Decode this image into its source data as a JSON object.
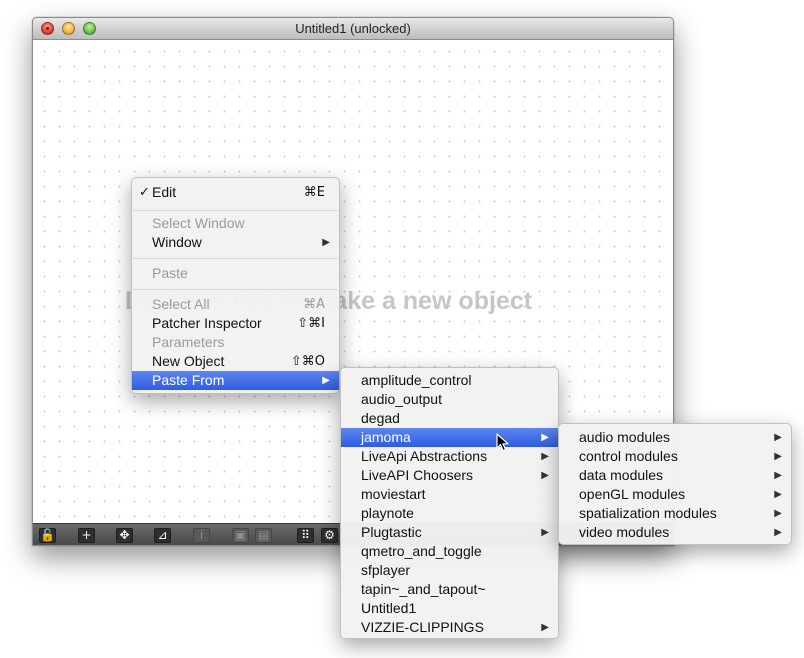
{
  "window": {
    "title": "Untitled1 (unlocked)",
    "canvas_hint": "Double-click to make a new object"
  },
  "toolbar": {
    "buttons": [
      {
        "icon": "lock-icon",
        "glyph": "🔓"
      },
      {
        "icon": "plus-icon",
        "glyph": "+"
      },
      {
        "icon": "move-icon",
        "glyph": "✥"
      },
      {
        "icon": "presentation-icon",
        "glyph": "⊿"
      },
      {
        "icon": "info-icon",
        "glyph": "i"
      },
      {
        "icon": "object-icon",
        "glyph": "▣"
      },
      {
        "icon": "object-stack-icon",
        "glyph": "▤"
      },
      {
        "icon": "grid-icon",
        "glyph": "⠿"
      },
      {
        "icon": "gear-icon",
        "glyph": "⚙"
      }
    ]
  },
  "context_menu": {
    "items": [
      {
        "label": "Edit",
        "checked": true,
        "check_glyph": "✓",
        "shortcut": "⌘E",
        "enabled": true
      },
      {
        "label": "Select Window",
        "enabled": false
      },
      {
        "label": "Window",
        "submenu": true,
        "enabled": true
      },
      {
        "label": "Paste",
        "enabled": false
      },
      {
        "label": "Select All",
        "shortcut": "⌘A",
        "enabled": false
      },
      {
        "label": "Patcher Inspector",
        "shortcut": "⇧⌘I",
        "enabled": true
      },
      {
        "label": "Parameters",
        "enabled": false
      },
      {
        "label": "New Object",
        "shortcut": "⇧⌘O",
        "enabled": true
      },
      {
        "label": "Paste From",
        "submenu": true,
        "enabled": true,
        "selected": true
      }
    ]
  },
  "paste_from_menu": {
    "items": [
      {
        "label": "amplitude_control"
      },
      {
        "label": "audio_output"
      },
      {
        "label": "degad"
      },
      {
        "label": "jamoma",
        "submenu": true,
        "selected": true
      },
      {
        "label": "LiveApi Abstractions",
        "submenu": true
      },
      {
        "label": "LiveAPI Choosers",
        "submenu": true
      },
      {
        "label": "moviestart"
      },
      {
        "label": "playnote"
      },
      {
        "label": "Plugtastic",
        "submenu": true
      },
      {
        "label": "qmetro_and_toggle"
      },
      {
        "label": "sfplayer"
      },
      {
        "label": "tapin~_and_tapout~"
      },
      {
        "label": "Untitled1"
      },
      {
        "label": "VIZZIE-CLIPPINGS",
        "submenu": true
      }
    ]
  },
  "jamoma_menu": {
    "items": [
      {
        "label": "audio modules",
        "submenu": true
      },
      {
        "label": "control modules",
        "submenu": true
      },
      {
        "label": "data modules",
        "submenu": true
      },
      {
        "label": "openGL modules",
        "submenu": true
      },
      {
        "label": "spatialization modules",
        "submenu": true
      },
      {
        "label": "video modules",
        "submenu": true
      }
    ]
  },
  "glyphs": {
    "submenu_arrow": "▶"
  },
  "colors": {
    "selection": "#3b6de6",
    "toolbar": "#555555"
  }
}
